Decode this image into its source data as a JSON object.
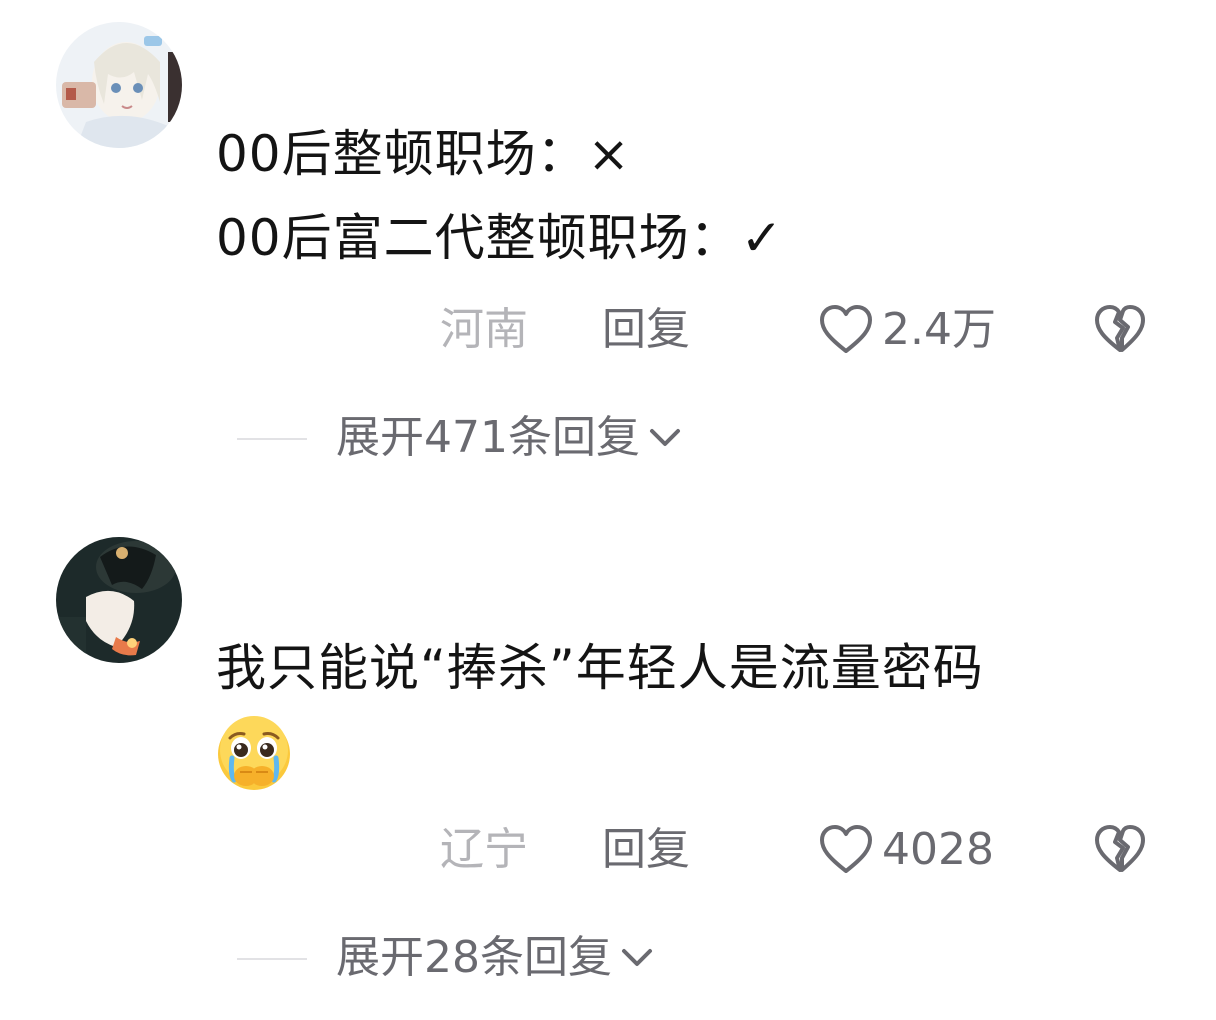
{
  "comments": [
    {
      "avatar": "anime-girl-avatar",
      "lines": [
        "00后整顿职场：×",
        "00后富二代整顿职场：✓"
      ],
      "location": "河南",
      "reply_label": "回复",
      "likes": "2.4万",
      "expand_label": "展开471条回复"
    },
    {
      "avatar": "dark-figure-avatar",
      "lines": [
        "我只能说“捧杀”年轻人是流量密码"
      ],
      "emoji": "pleading-crying-face-emoji",
      "location": "辽宁",
      "reply_label": "回复",
      "likes": "4028",
      "expand_label": "展开28条回复"
    }
  ],
  "icons": {
    "like": "heart-outline-icon",
    "dislike": "broken-heart-icon",
    "expand": "chevron-down-icon"
  },
  "colors": {
    "text_primary": "#141414",
    "text_secondary": "#6a6a70",
    "text_location": "#b4b4b8"
  }
}
